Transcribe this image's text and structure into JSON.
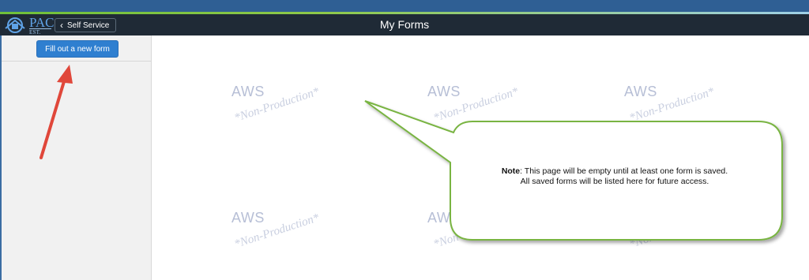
{
  "header": {
    "logo_text": "PAC",
    "logo_sub": "EST. 2004",
    "back_label": "Self Service",
    "title": "My Forms"
  },
  "sidebar": {
    "new_form_label": "Fill out a new form"
  },
  "watermark": {
    "aws": "AWS",
    "non_production": "*Non-Production*"
  },
  "callout": {
    "note_label": "Note",
    "note_line1": ": This page will be empty until at least one form is saved.",
    "note_line2": "All saved forms will be listed here for future access."
  },
  "colors": {
    "header_bg": "#1f2a36",
    "top_strip": "#2f5f94",
    "button_blue": "#2f7fd0",
    "arrow_red": "#e0473a",
    "callout_border": "#79b443"
  }
}
